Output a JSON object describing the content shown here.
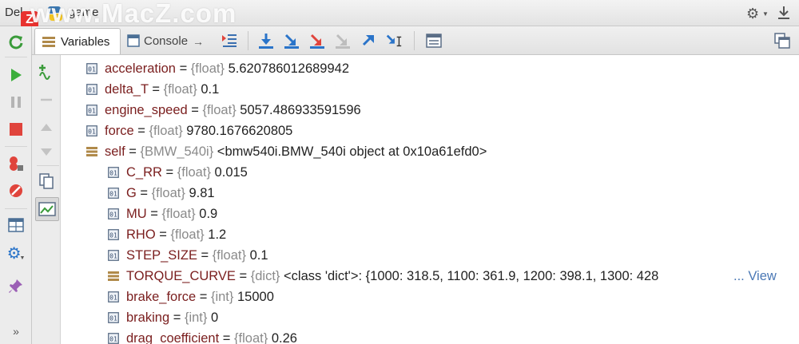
{
  "titlebar": {
    "prefix": "Del",
    "name": "game",
    "watermark": "www.MacZ.com",
    "watermark_badge": "Z",
    "icons": [
      "python-logo-icon",
      "gear-icon",
      "download-icon"
    ]
  },
  "tabs": [
    {
      "label": "Variables",
      "icon": "list-icon",
      "active": true
    },
    {
      "label": "Console",
      "icon": "console-icon",
      "active": false
    }
  ],
  "toolbar_icons": [
    "show-execution-point-icon",
    "step-over-icon",
    "step-into-icon",
    "step-into-my-code-icon",
    "force-step-into-icon",
    "step-out-icon",
    "run-to-cursor-icon",
    "evaluate-expression-icon",
    "restore-layout-icon"
  ],
  "left_toolbar_icons": [
    "rerun-icon",
    "resume-icon",
    "pause-icon",
    "stop-icon",
    "view-breakpoints-icon",
    "mute-breakpoints-icon",
    "layout-icon",
    "settings-icon",
    "pin-icon",
    "more-icon"
  ],
  "left_toolbar_more": "»",
  "colors": {
    "name": "#7a1e1e",
    "type": "#8a8a8a",
    "link": "#4a78b5",
    "accent": "#2a74c9"
  },
  "variables": [
    {
      "name": "acceleration",
      "type": "{float}",
      "value": "5.620786012689942",
      "level": 0,
      "kind": "primitive"
    },
    {
      "name": "delta_T",
      "type": "{float}",
      "value": "0.1",
      "level": 0,
      "kind": "primitive"
    },
    {
      "name": "engine_speed",
      "type": "{float}",
      "value": "5057.486933591596",
      "level": 0,
      "kind": "primitive"
    },
    {
      "name": "force",
      "type": "{float}",
      "value": "9780.1676620805",
      "level": 0,
      "kind": "primitive"
    },
    {
      "name": "self",
      "type": "{BMW_540i}",
      "value": "<bmw540i.BMW_540i object at 0x10a61efd0>",
      "level": 0,
      "kind": "object",
      "expanded": true
    },
    {
      "name": "C_RR",
      "type": "{float}",
      "value": "0.015",
      "level": 1,
      "kind": "primitive"
    },
    {
      "name": "G",
      "type": "{float}",
      "value": "9.81",
      "level": 1,
      "kind": "primitive"
    },
    {
      "name": "MU",
      "type": "{float}",
      "value": "0.9",
      "level": 1,
      "kind": "primitive"
    },
    {
      "name": "RHO",
      "type": "{float}",
      "value": "1.2",
      "level": 1,
      "kind": "primitive"
    },
    {
      "name": "STEP_SIZE",
      "type": "{float}",
      "value": "0.1",
      "level": 1,
      "kind": "primitive"
    },
    {
      "name": "TORQUE_CURVE",
      "type": "{dict}",
      "value": "<class 'dict'>: {1000: 318.5, 1100: 361.9, 1200: 398.1, 1300: 428",
      "level": 1,
      "kind": "object",
      "expanded": false,
      "link": "... View"
    },
    {
      "name": "brake_force",
      "type": "{int}",
      "value": "15000",
      "level": 1,
      "kind": "primitive"
    },
    {
      "name": "braking",
      "type": "{int}",
      "value": "0",
      "level": 1,
      "kind": "primitive"
    },
    {
      "name": "drag_coefficient",
      "type": "{float}",
      "value": "0.26",
      "level": 1,
      "kind": "primitive"
    }
  ]
}
